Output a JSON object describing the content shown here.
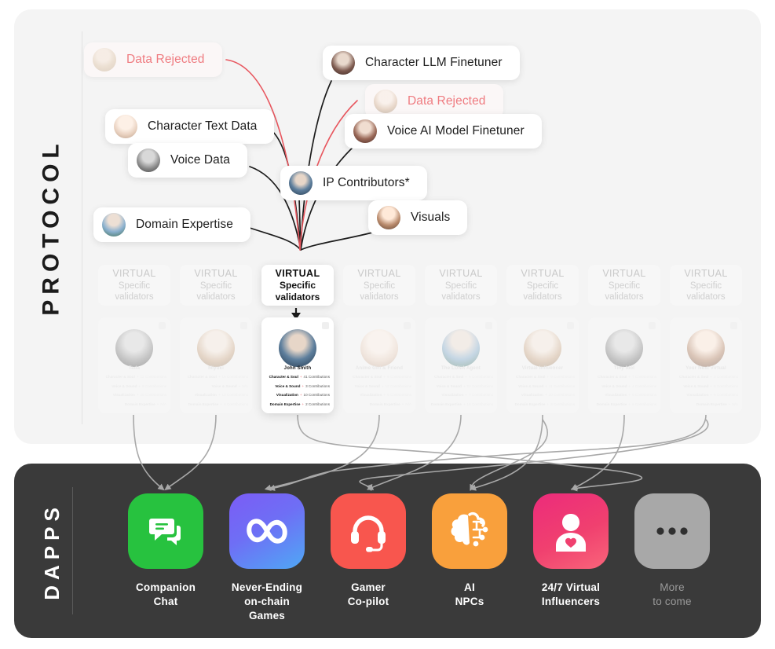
{
  "sections": {
    "protocol_label": "PROTOCOL",
    "dapps_label": "DAPPS"
  },
  "colors": {
    "protocol_bg": "#f4f4f4",
    "dapps_bg": "#3a3a3a",
    "rejected_text": "#ef7b80",
    "flow_black": "#1c1c1c",
    "flow_red": "#e8575f",
    "flow_gray": "#a8a8a8"
  },
  "source_nodes": [
    {
      "id": "data-rejected-1",
      "label": "Data Rejected",
      "state": "rejected",
      "avatar": "av-a"
    },
    {
      "id": "character-llm-finetuner",
      "label": "Character LLM Finetuner",
      "state": "normal",
      "avatar": "av-b"
    },
    {
      "id": "data-rejected-2",
      "label": "Data Rejected",
      "state": "rejected",
      "avatar": "av-c"
    },
    {
      "id": "character-text-data",
      "label": "Character Text Data",
      "state": "normal",
      "avatar": "av-i"
    },
    {
      "id": "voice-ai-model-finetuner",
      "label": "Voice AI Model Finetuner",
      "state": "normal",
      "avatar": "av-e"
    },
    {
      "id": "voice-data",
      "label": "Voice Data",
      "state": "normal",
      "avatar": "av-d"
    },
    {
      "id": "ip-contributors",
      "label": "IP Contributors*",
      "state": "normal",
      "avatar": "av-g"
    },
    {
      "id": "domain-expertise",
      "label": "Domain Expertise",
      "state": "normal",
      "avatar": "av-h"
    },
    {
      "id": "visuals",
      "label": "Visuals",
      "state": "normal",
      "avatar": "av-f"
    }
  ],
  "validator_header": {
    "line1": "VIRTUAL",
    "line2": "Specific",
    "line3": "validators",
    "count": 8,
    "active_index": 2
  },
  "agent_cards": [
    {
      "name": "Tada",
      "active": false,
      "avatar": "av-d",
      "stats": [
        {
          "label": "Character & Soul",
          "value": "12 Contributions"
        },
        {
          "label": "Voice & Sound",
          "value": "8 Contributions"
        },
        {
          "label": "Visualization",
          "value": "20 Contributions"
        },
        {
          "label": "Domain Expertise",
          "value": "N/A"
        }
      ]
    },
    {
      "name": "Miyuki",
      "active": false,
      "avatar": "av-c",
      "stats": [
        {
          "label": "Character & Soul",
          "value": "15 Contributions"
        },
        {
          "label": "Voice & Sound",
          "value": "N/A"
        },
        {
          "label": "Visualization",
          "value": "10 Contributions"
        },
        {
          "label": "Domain Expertise",
          "value": "4 Contributions"
        }
      ]
    },
    {
      "name": "John Smith",
      "active": true,
      "avatar": "av-g",
      "stats": [
        {
          "label": "Character & Soul",
          "value": "41 Contributions"
        },
        {
          "label": "Voice & Sound",
          "value": "3 Contributions"
        },
        {
          "label": "Visualization",
          "value": "10 Contributions"
        },
        {
          "label": "Domain Expertise",
          "value": "2 Contributions"
        }
      ]
    },
    {
      "name": "Anime Girl & Friend",
      "active": false,
      "avatar": "av-i",
      "stats": [
        {
          "label": "Character & Soul",
          "value": "6 Contributions"
        },
        {
          "label": "Voice & Sound",
          "value": "12 Contributions"
        },
        {
          "label": "Visualization",
          "value": "9 Contributions"
        },
        {
          "label": "Domain Expertise",
          "value": "N/A"
        }
      ]
    },
    {
      "name": "The LUNA Agent",
      "active": false,
      "avatar": "av-h",
      "stats": [
        {
          "label": "Character & Soul",
          "value": "5 Contributions"
        },
        {
          "label": "Voice & Sound",
          "value": "22 Contributions"
        },
        {
          "label": "Visualization",
          "value": "7 Contributions"
        },
        {
          "label": "Domain Expertise",
          "value": "18 Contributions"
        }
      ]
    },
    {
      "name": "Virtual Influencer",
      "active": false,
      "avatar": "av-c",
      "stats": [
        {
          "label": "Character & Soul",
          "value": "9 Contributions"
        },
        {
          "label": "Voice & Sound",
          "value": "11 Contributions"
        },
        {
          "label": "Visualization",
          "value": "30 Contributions"
        },
        {
          "label": "Domain Expertise",
          "value": "3 Contributions"
        }
      ]
    },
    {
      "name": "Tiny Idol",
      "active": false,
      "avatar": "av-d",
      "stats": [
        {
          "label": "Character & Soul",
          "value": "7 Contributions"
        },
        {
          "label": "Voice & Sound",
          "value": "4 Contributions"
        },
        {
          "label": "Visualization",
          "value": "5 Contributions"
        },
        {
          "label": "Domain Expertise",
          "value": "6 Contributions"
        }
      ]
    },
    {
      "name": "Your Next Virtual",
      "active": false,
      "avatar": "av-f",
      "stats": [
        {
          "label": "Character & Soul",
          "value": "3 Contributions"
        },
        {
          "label": "Voice & Sound",
          "value": "8 Contributions"
        },
        {
          "label": "Visualization",
          "value": "6 Contributions"
        },
        {
          "label": "Domain Expertise",
          "value": "N/A"
        }
      ]
    }
  ],
  "dapps": [
    {
      "id": "companion-chat",
      "label": "Companion\nChat",
      "icon": "chat-bubbles-icon",
      "color": "#27c23f",
      "color2": "#27c23f"
    },
    {
      "id": "never-ending-games",
      "label": "Never-Ending\non-chain Games",
      "icon": "infinity-icon",
      "color": "#7b5cf5",
      "color2": "#4fa8f5"
    },
    {
      "id": "gamer-copilot",
      "label": "Gamer\nCo-pilot",
      "icon": "headset-icon",
      "color": "#f8564e",
      "color2": "#f8564e"
    },
    {
      "id": "ai-npcs",
      "label": "AI\nNPCs",
      "icon": "brain-circuit-icon",
      "color": "#f9a03c",
      "color2": "#f9a03c"
    },
    {
      "id": "virtual-influencers",
      "label": "24/7 Virtual\nInfluencers",
      "icon": "person-heart-icon",
      "color": "#ec2b7b",
      "color2": "#f9657a"
    },
    {
      "id": "more-to-come",
      "label": "More\nto come",
      "icon": "ellipsis-icon",
      "color": "#a8a8a8",
      "color2": "#a8a8a8"
    }
  ]
}
